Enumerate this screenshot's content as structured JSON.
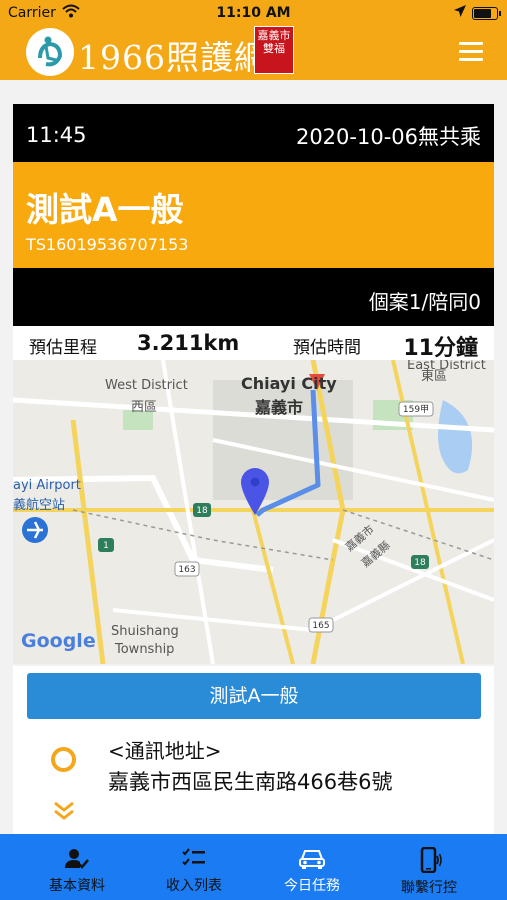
{
  "status_bar": {
    "carrier": "Carrier",
    "time": "11:10 AM"
  },
  "navbar": {
    "logo_text": "1966照護網",
    "seal_text": "嘉義市 雙福",
    "menu_icon": "hamburger-menu-icon"
  },
  "trip": {
    "time": "11:45",
    "date_share": "2020-10-06無共乘",
    "title": "測試A一般",
    "code": "TS16019536707153",
    "passengers": "個案1/陪同0",
    "distance_label": "預估里程",
    "distance_value": "3.211km",
    "duration_label": "預估時間",
    "duration_value": "11分鐘"
  },
  "map": {
    "labels": {
      "west_district": "West District",
      "west_district_zh": "西區",
      "city_en": "Chiayi City",
      "city_zh": "嘉義市",
      "east_district": "East District",
      "east_district_zh": "東區",
      "airport_en": "ayi Airport",
      "airport_zh": "義航空站",
      "town_en": "Shuishang",
      "town_en2": "Township",
      "county1": "嘉義市",
      "county2": "嘉義縣",
      "google": "Google"
    },
    "shields": [
      "18",
      "1",
      "163",
      "18",
      "165",
      "159甲"
    ]
  },
  "task_button": "測試A一般",
  "address": {
    "label": "<通訊地址>",
    "value": "嘉義市西區民生南路466巷6號"
  },
  "tabs": [
    {
      "label": "基本資料",
      "icon": "user-check-icon"
    },
    {
      "label": "收入列表",
      "icon": "checklist-icon"
    },
    {
      "label": "今日任務",
      "icon": "car-icon"
    },
    {
      "label": "聯繫行控",
      "icon": "phone-vibrate-icon"
    }
  ],
  "colors": {
    "brand": "#f5a816",
    "tabbar": "#1a7bf2",
    "button": "#2a8bd6",
    "route": "#5b8ee8",
    "pin": "#4a55e6"
  }
}
